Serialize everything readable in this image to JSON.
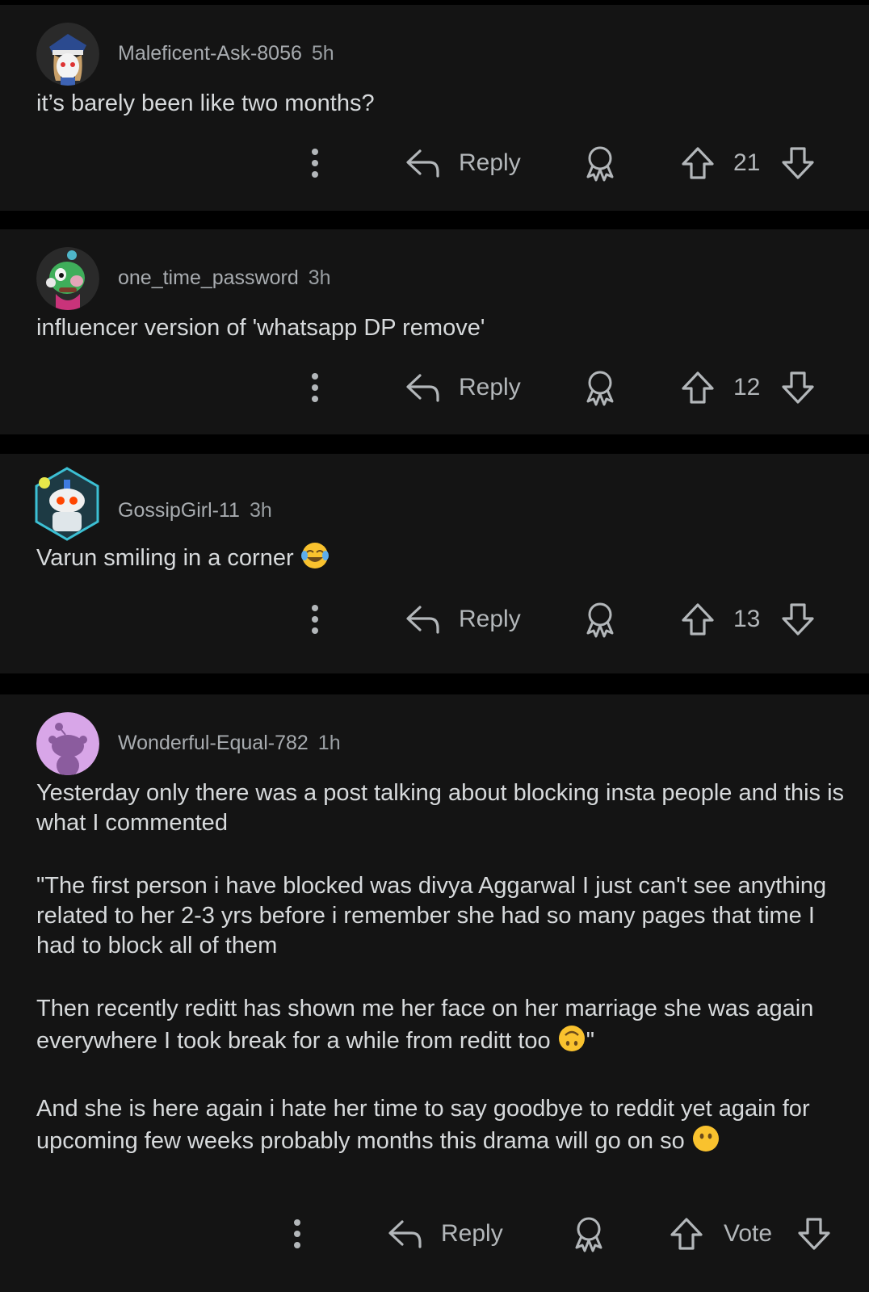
{
  "comments": [
    {
      "username": "Maleficent-Ask-8056",
      "time": "5h",
      "avatar_icon": "sailor-avatar-icon",
      "body": [
        "it’s barely been like two months?"
      ],
      "reply_label": "Reply",
      "score": "21"
    },
    {
      "username": "one_time_password",
      "time": "3h",
      "avatar_icon": "green-creature-avatar-icon",
      "body": [
        "influencer version of 'whatsapp DP remove'"
      ],
      "reply_label": "Reply",
      "score": "12"
    },
    {
      "username": "GossipGirl-11",
      "time": "3h",
      "avatar_icon": "robot-snoo-avatar-icon",
      "body": [
        "Varun smiling in a corner"
      ],
      "body_emoji": "face-with-tears-of-joy-emoji",
      "reply_label": "Reply",
      "score": "13"
    },
    {
      "username": "Wonderful-Equal-782",
      "time": "1h",
      "avatar_icon": "purple-snoo-avatar-icon",
      "body": [
        "Yesterday only there was a post talking about blocking insta people and this is what I commented",
        "\"The first person i have blocked was divya Aggarwal I just can't see anything related to her 2-3 yrs before i remember she had so many pages that time I had to block all of them",
        "Then recently reditt has shown me her face on her marriage she was again everywhere I took break for a while from reditt too",
        "And she is here again i hate her time to say goodbye to reddit yet again for upcoming few weeks probably months this drama will go on so"
      ],
      "para3_suffix": "\"",
      "emojis": [
        "upside-down-face-emoji",
        "face-without-mouth-emoji"
      ],
      "reply_label": "Reply",
      "score": "Vote"
    }
  ],
  "colors": {
    "background": "#000000",
    "card": "#141414",
    "text": "#d7dadc",
    "muted": "#9a9fa3",
    "emoji_yellow": "#f9c22e"
  }
}
